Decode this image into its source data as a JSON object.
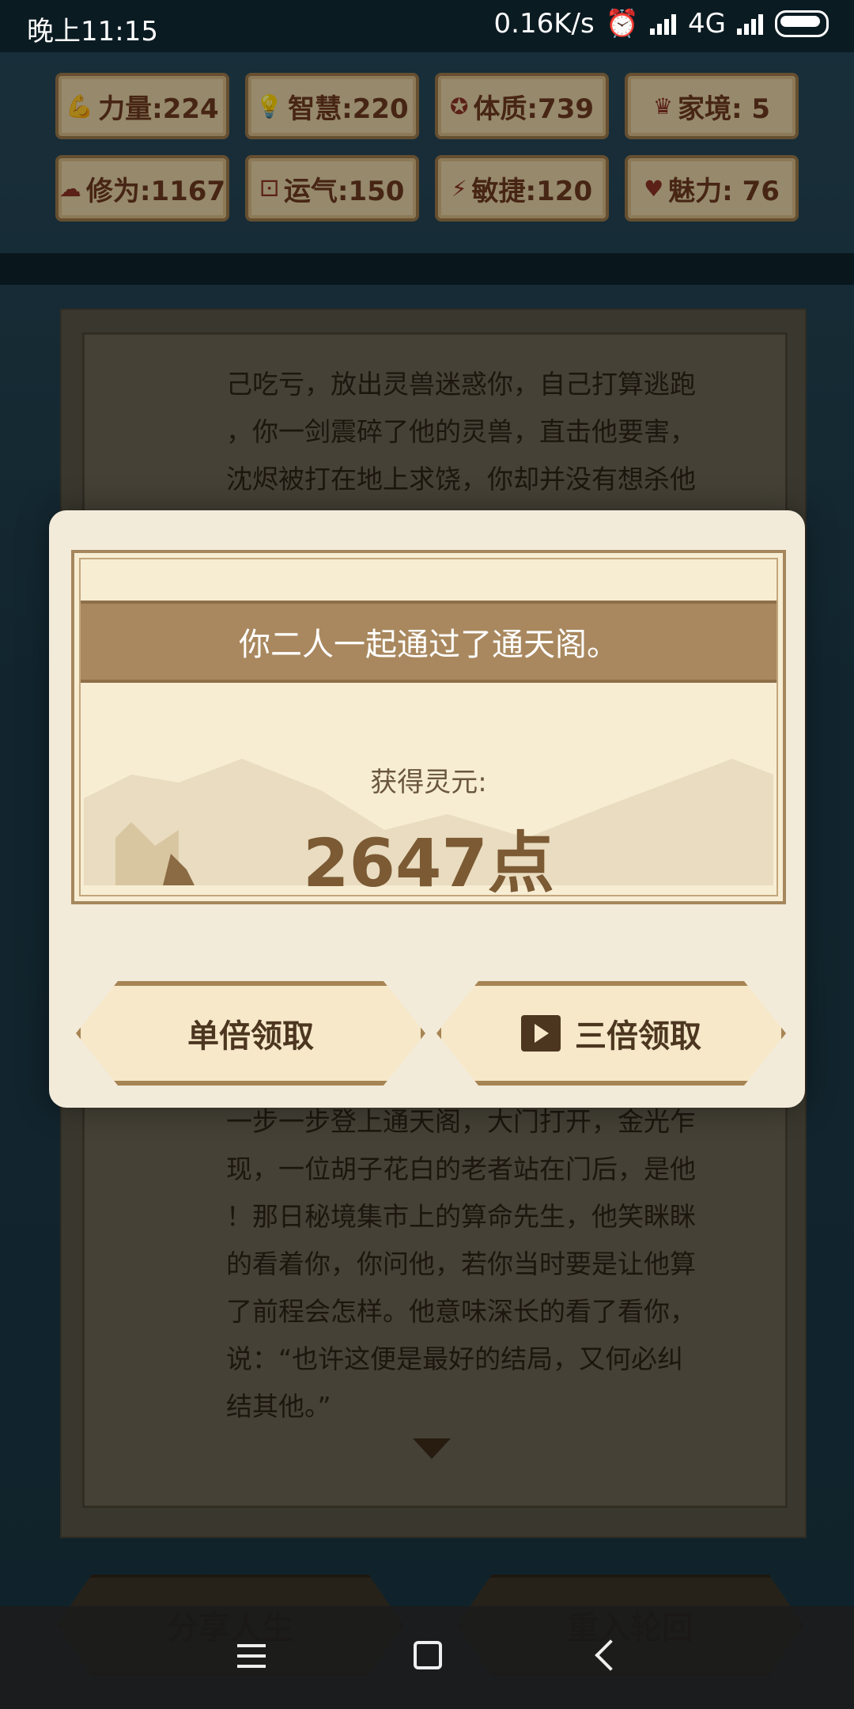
{
  "status_bar": {
    "time": "晚上11:15",
    "speed": "0.16K/s",
    "network": "4G"
  },
  "stats": [
    {
      "label": "力量:224",
      "icon": "strength-icon"
    },
    {
      "label": "智慧:220",
      "icon": "wisdom-icon"
    },
    {
      "label": "体质:739",
      "icon": "constitution-icon"
    },
    {
      "label": "家境: 5",
      "icon": "family-icon"
    },
    {
      "label": "修为:1167",
      "icon": "cultivation-icon"
    },
    {
      "label": "运气:150",
      "icon": "luck-icon"
    },
    {
      "label": "敏捷:120",
      "icon": "agility-icon"
    },
    {
      "label": "魅力: 76",
      "icon": "charm-icon"
    }
  ],
  "story": {
    "top_lines": [
      "己吃亏，放出灵兽迷惑你，自己打算逃跑",
      "，你一剑震碎了他的灵兽，直击他要害，",
      "沈烬被打在地上求饶，你却并没有想杀他"
    ],
    "bottom_lines": [
      "一步一步登上通天阁，大门打开，金光乍",
      "现，一位胡子花白的老者站在门后，是他",
      "！那日秘境集市上的算命先生，他笑眯眯",
      "的看着你，你问他，若你当时要是让他算",
      "了前程会怎样。他意味深长的看了看你，",
      "说：“也许这便是最好的结局，又何必纠",
      "结其他。”"
    ]
  },
  "modal": {
    "title": "你二人一起通过了通天阁。",
    "reward_label": "获得灵元:",
    "reward_value": "2647点",
    "single_button": "单倍领取",
    "triple_button": "三倍领取"
  },
  "bottom_buttons": {
    "share": "分享人生",
    "restart": "重入轮回"
  }
}
